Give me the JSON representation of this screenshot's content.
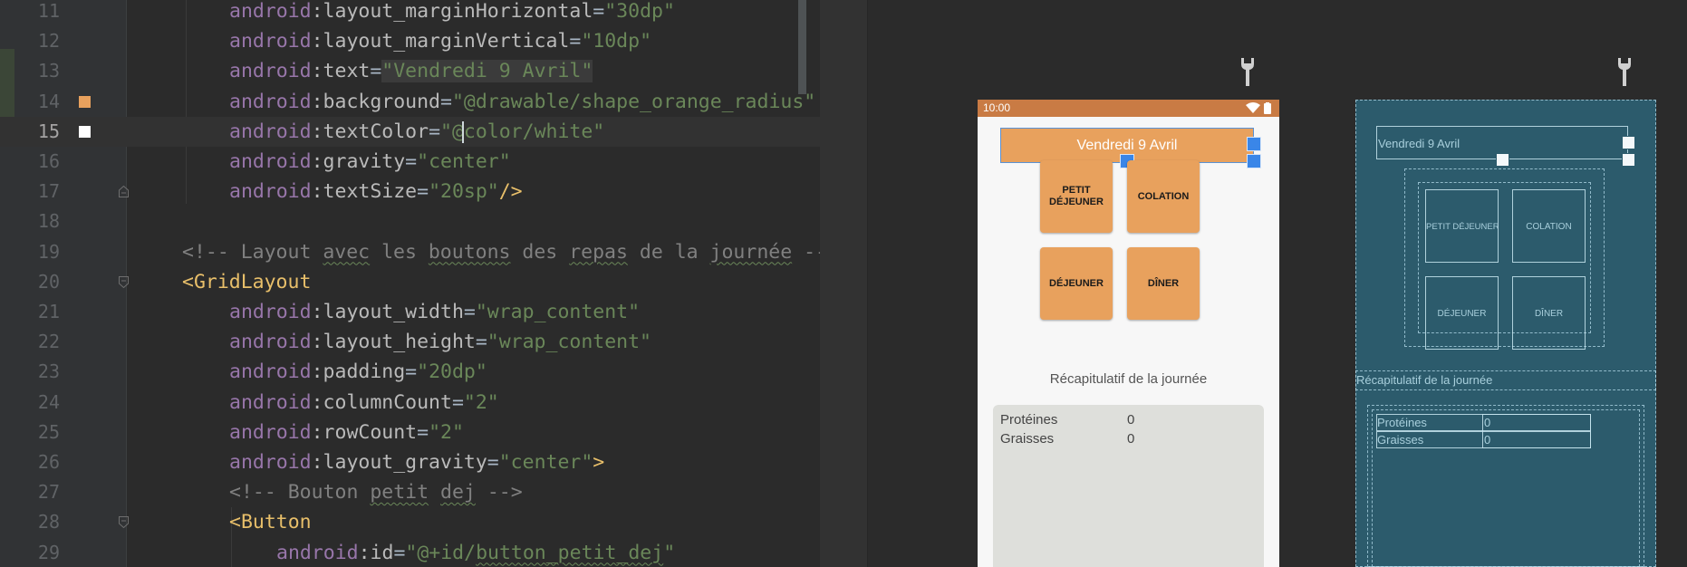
{
  "editor": {
    "lines": [
      {
        "n": "11",
        "parts": [
          [
            "ns",
            "android"
          ],
          [
            "attr",
            ":layout_marginHorizontal"
          ],
          [
            "",
            "="
          ],
          [
            "str",
            "\"30dp\""
          ]
        ]
      },
      {
        "n": "12",
        "parts": [
          [
            "ns",
            "android"
          ],
          [
            "attr",
            ":layout_marginVertical"
          ],
          [
            "",
            "="
          ],
          [
            "str",
            "\"10dp\""
          ]
        ]
      },
      {
        "n": "13",
        "parts": [
          [
            "ns",
            "android"
          ],
          [
            "attr",
            ":text"
          ],
          [
            "",
            "="
          ],
          [
            "str hl",
            "\"Vendredi 9 Avril\""
          ]
        ]
      },
      {
        "n": "14",
        "parts": [
          [
            "ns",
            "android"
          ],
          [
            "attr",
            ":background"
          ],
          [
            "",
            "="
          ],
          [
            "str",
            "\"@drawable/shape_orange_radius\""
          ]
        ]
      },
      {
        "n": "15",
        "parts": [
          [
            "ns",
            "android"
          ],
          [
            "attr",
            ":textColor"
          ],
          [
            "",
            "="
          ],
          [
            "str",
            "\"@"
          ],
          [
            "caret",
            ""
          ],
          [
            "str",
            "color/white\""
          ]
        ]
      },
      {
        "n": "16",
        "parts": [
          [
            "ns",
            "android"
          ],
          [
            "attr",
            ":gravity"
          ],
          [
            "",
            "="
          ],
          [
            "str",
            "\"center\""
          ]
        ]
      },
      {
        "n": "17",
        "parts": [
          [
            "ns",
            "android"
          ],
          [
            "attr",
            ":textSize"
          ],
          [
            "",
            "="
          ],
          [
            "str",
            "\"20sp\""
          ],
          [
            "tag",
            "/>"
          ]
        ]
      },
      {
        "n": "18",
        "parts": []
      },
      {
        "n": "19",
        "parts": [
          [
            "cmt",
            "<!-- Layout "
          ],
          [
            "cmt squig",
            "avec"
          ],
          [
            "cmt",
            " les "
          ],
          [
            "cmt squig",
            "boutons"
          ],
          [
            "cmt",
            " des "
          ],
          [
            "cmt squig",
            "repas"
          ],
          [
            "cmt",
            " de la "
          ],
          [
            "cmt squig",
            "journée"
          ],
          [
            "cmt",
            " --"
          ]
        ]
      },
      {
        "n": "20",
        "parts": [
          [
            "tag",
            "<GridLayout"
          ]
        ]
      },
      {
        "n": "21",
        "parts": [
          [
            "ns",
            "android"
          ],
          [
            "attr",
            ":layout_width"
          ],
          [
            "",
            "="
          ],
          [
            "str",
            "\"wrap_content\""
          ]
        ]
      },
      {
        "n": "22",
        "parts": [
          [
            "ns",
            "android"
          ],
          [
            "attr",
            ":layout_height"
          ],
          [
            "",
            "="
          ],
          [
            "str",
            "\"wrap_content\""
          ]
        ]
      },
      {
        "n": "23",
        "parts": [
          [
            "ns",
            "android"
          ],
          [
            "attr",
            ":padding"
          ],
          [
            "",
            "="
          ],
          [
            "str",
            "\"20dp\""
          ]
        ]
      },
      {
        "n": "24",
        "parts": [
          [
            "ns",
            "android"
          ],
          [
            "attr",
            ":columnCount"
          ],
          [
            "",
            "="
          ],
          [
            "str",
            "\"2\""
          ]
        ]
      },
      {
        "n": "25",
        "parts": [
          [
            "ns",
            "android"
          ],
          [
            "attr",
            ":rowCount"
          ],
          [
            "",
            "="
          ],
          [
            "str",
            "\"2\""
          ]
        ]
      },
      {
        "n": "26",
        "parts": [
          [
            "ns",
            "android"
          ],
          [
            "attr",
            ":layout_gravity"
          ],
          [
            "",
            "="
          ],
          [
            "str",
            "\"center\""
          ],
          [
            "tag",
            ">"
          ]
        ]
      },
      {
        "n": "27",
        "parts": [
          [
            "cmt",
            "<!-- Bouton "
          ],
          [
            "cmt squig",
            "petit"
          ],
          [
            "cmt",
            " "
          ],
          [
            "cmt squig",
            "dej"
          ],
          [
            "cmt",
            " -->"
          ]
        ]
      },
      {
        "n": "28",
        "parts": [
          [
            "tag",
            "<Button"
          ]
        ]
      },
      {
        "n": "29",
        "parts": [
          [
            "ns",
            "android"
          ],
          [
            "attr",
            ":id"
          ],
          [
            "",
            "="
          ],
          [
            "str",
            "\"@+id/"
          ],
          [
            "str squig",
            "button_petit_dej"
          ],
          [
            "str",
            "\""
          ]
        ]
      }
    ],
    "colors": {
      "swatch_orange": "#e8a15d",
      "swatch_white": "#ffffff"
    }
  },
  "preview": {
    "status_time": "10:00",
    "day_header": "Vendredi 9 Avril",
    "meal_buttons": {
      "petit_dejeuner": "PETIT DÉJEUNER",
      "collation": "COLATION",
      "dejeuner": "DÉJEUNER",
      "diner": "DÎNER"
    },
    "summary_title": "Récapitulatif de la journée",
    "summary_rows": [
      {
        "label": "Protéines",
        "value": "0"
      },
      {
        "label": "Graisses",
        "value": "0"
      }
    ],
    "colors": {
      "accent_orange": "#e8a15d",
      "status_bar": "#c97b44",
      "blueprint_bg": "#2c5b6c"
    }
  },
  "blueprint": {
    "day_header": "Vendredi 9 Avril",
    "meal_buttons": {
      "petit_dejeuner": "PETIT DÉJEUNER",
      "collation": "COLATION",
      "dejeuner": "DÉJEUNER",
      "diner": "DÎNER"
    },
    "summary_title": "Récapitulatif de la journée",
    "summary_rows": [
      {
        "label": "Protéines",
        "value": "0"
      },
      {
        "label": "Graisses",
        "value": "0"
      }
    ]
  }
}
